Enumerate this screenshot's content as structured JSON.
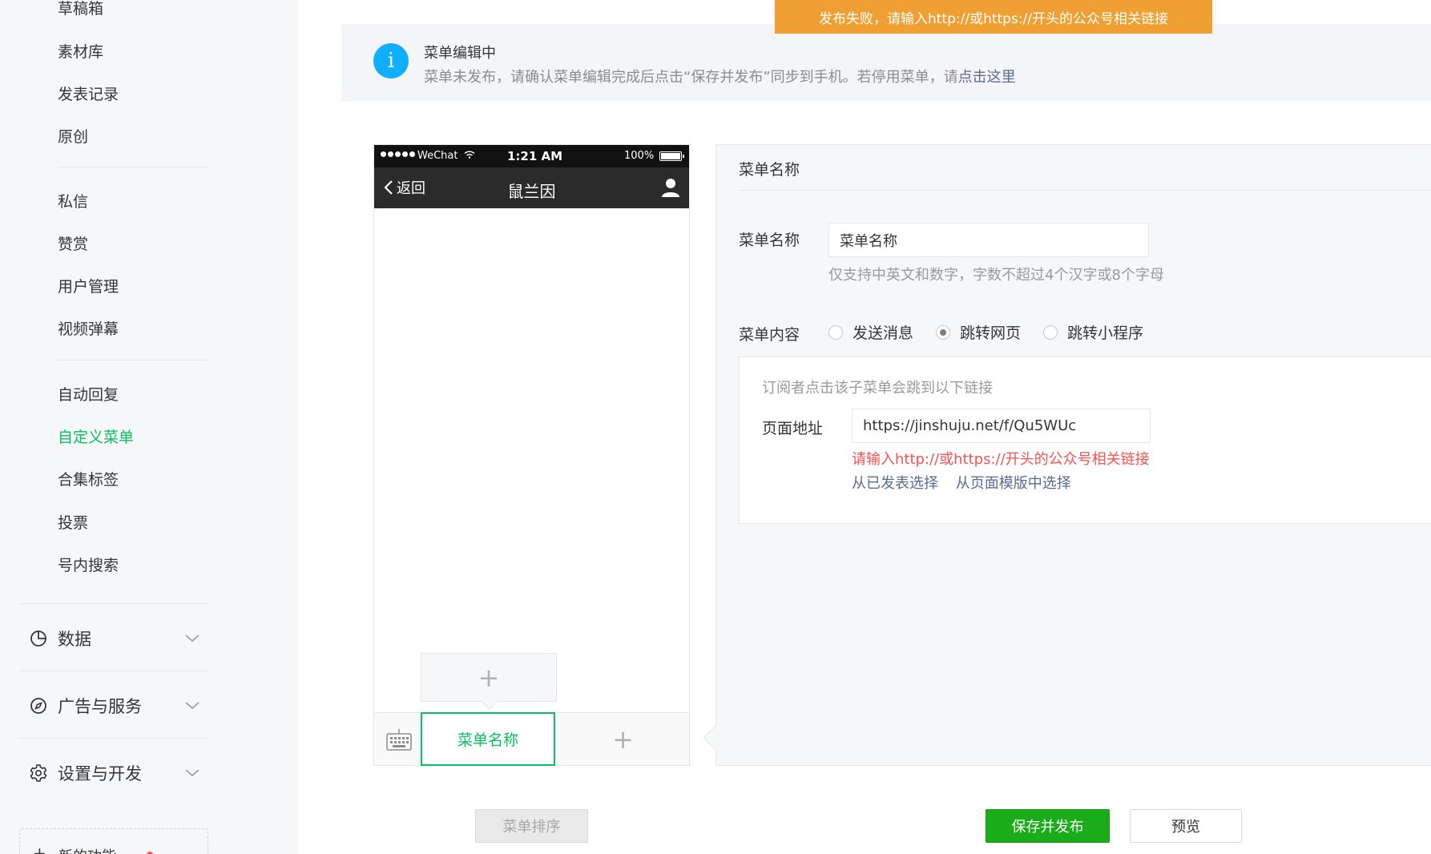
{
  "toast": {
    "text": "发布失败，请输入http://或https://开头的公众号相关链接"
  },
  "sidebar": {
    "items": [
      {
        "label": "草稿箱"
      },
      {
        "label": "素材库"
      },
      {
        "label": "发表记录"
      },
      {
        "label": "原创"
      },
      {
        "label": "私信"
      },
      {
        "label": "赞赏"
      },
      {
        "label": "用户管理"
      },
      {
        "label": "视频弹幕"
      },
      {
        "label": "自动回复"
      },
      {
        "label": "自定义菜单",
        "active": true
      },
      {
        "label": "合集标签"
      },
      {
        "label": "投票"
      },
      {
        "label": "号内搜索"
      }
    ],
    "groups": [
      {
        "label": "数据",
        "icon": "pie-chart-icon"
      },
      {
        "label": "广告与服务",
        "icon": "compass-icon"
      },
      {
        "label": "设置与开发",
        "icon": "gear-icon"
      }
    ],
    "new_feature": {
      "label": "新的功能"
    },
    "active_color": "#07c160"
  },
  "notice": {
    "title": "菜单编辑中",
    "desc": "菜单未发布，请确认菜单编辑完成后点击“保存并发布”同步到手机。若停用菜单，请",
    "link": "点击这里"
  },
  "phone": {
    "status": {
      "carrier": "WeChat",
      "time": "1:21 AM",
      "battery": "100%"
    },
    "nav": {
      "back": "返回",
      "title": "鼠兰因"
    },
    "menu": {
      "active_tab": "菜单名称",
      "add_symbol": "+"
    }
  },
  "editor": {
    "header": "菜单名称",
    "name_label": "菜单名称",
    "name_value": "菜单名称",
    "name_hint": "仅支持中英文和数字，字数不超过4个汉字或8个字母",
    "content_label": "菜单内容",
    "options": [
      {
        "label": "发送消息",
        "checked": false
      },
      {
        "label": "跳转网页",
        "checked": true
      },
      {
        "label": "跳转小程序",
        "checked": false
      }
    ],
    "content": {
      "desc": "订阅者点击该子菜单会跳到以下链接",
      "url_label": "页面地址",
      "url_value": "https://jinshuju.net/f/Qu5WUc",
      "error": "请输入http://或https://开头的公众号相关链接",
      "link1": "从已发表选择",
      "link2": "从页面模版中选择"
    }
  },
  "buttons": {
    "sort": "菜单排序",
    "save": "保存并发布",
    "preview": "预览"
  },
  "colors": {
    "brand_green": "#07c160",
    "toast_orange": "#f0a032",
    "error_red": "#fa5151",
    "link_blue": "#576b95",
    "info_blue": "#10aeff"
  }
}
